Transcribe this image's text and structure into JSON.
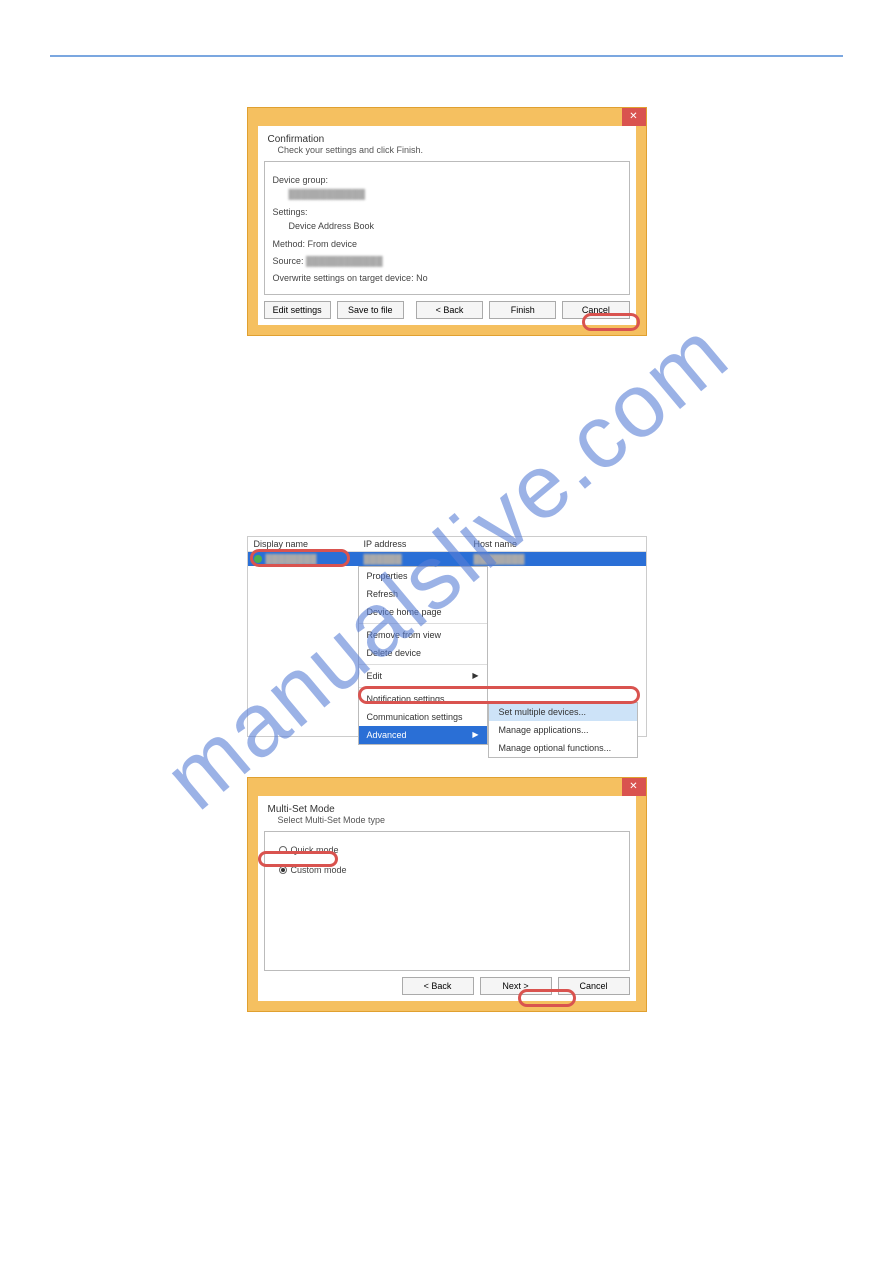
{
  "watermark": "manualslive.com",
  "page_number": "",
  "dialog1": {
    "close": "✕",
    "title": "Confirmation",
    "subtitle": "Check your settings and click Finish.",
    "device_group_label": "Device group:",
    "device_group_value": "████████████",
    "settings_label": "Settings:",
    "settings_value": "Device Address Book",
    "method_label": "Method:",
    "method_value": "From device",
    "source_label": "Source:",
    "source_value": "████████████",
    "overwrite_label": "Overwrite settings on target device:",
    "overwrite_value": "No",
    "btn_edit": "Edit settings",
    "btn_save": "Save to file",
    "btn_back": "< Back",
    "btn_finish": "Finish",
    "btn_cancel": "Cancel"
  },
  "device_table": {
    "col_display": "Display name",
    "col_ip": "IP address",
    "col_host": "Host name",
    "row_display": "████████",
    "row_ip": "██████",
    "row_host": "████████"
  },
  "context_menu": {
    "properties": "Properties",
    "refresh": "Refresh",
    "home": "Device home page",
    "remove": "Remove from view",
    "delete": "Delete device",
    "edit": "Edit",
    "notif": "Notification settings",
    "comm": "Communication settings",
    "advanced": "Advanced",
    "sub_set_multiple": "Set multiple devices...",
    "sub_manage_apps": "Manage applications...",
    "sub_manage_opt": "Manage optional functions..."
  },
  "dialog2": {
    "close": "✕",
    "title": "Multi-Set Mode",
    "subtitle": "Select Multi-Set Mode type",
    "quick": "Quick mode",
    "custom": "Custom mode",
    "btn_back": "< Back",
    "btn_next": "Next >",
    "btn_cancel": "Cancel"
  }
}
